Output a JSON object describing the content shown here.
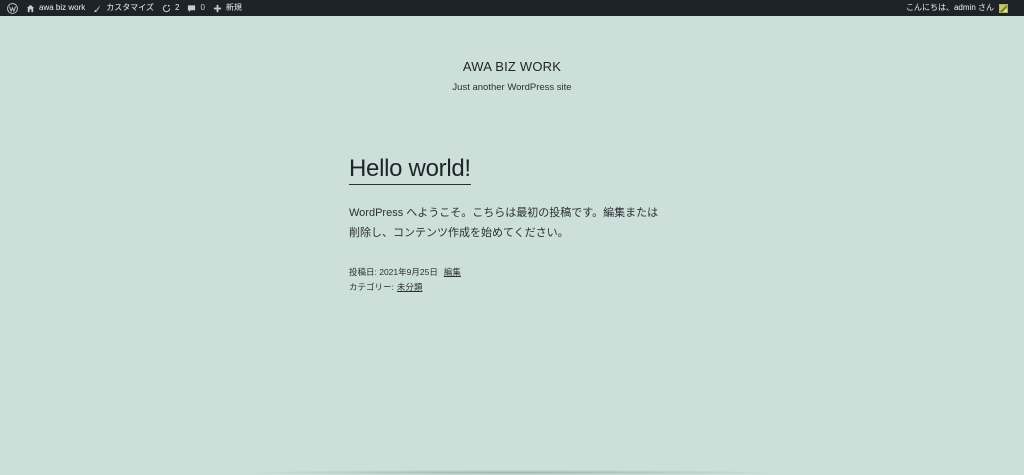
{
  "admin_bar": {
    "site_name": "awa biz work",
    "customize_label": "カスタマイズ",
    "updates_count": "2",
    "comments_count": "0",
    "new_label": "新規",
    "greeting": "こんにちは、admin さん"
  },
  "site": {
    "title": "AWA BIZ WORK",
    "description": "Just another WordPress site"
  },
  "post": {
    "title": "Hello world!",
    "content": "WordPress へようこそ。こちらは最初の投稿です。編集または削除し、コンテンツ作成を始めてください。",
    "posted_on_label": "投稿日: 2021年9月25日",
    "edit_label": "編集",
    "category_label": "カテゴリー:",
    "category_value": "未分類"
  },
  "colors": {
    "background": "#cce0d9",
    "admin_bar": "#1e2327",
    "text": "#2b2f33"
  }
}
